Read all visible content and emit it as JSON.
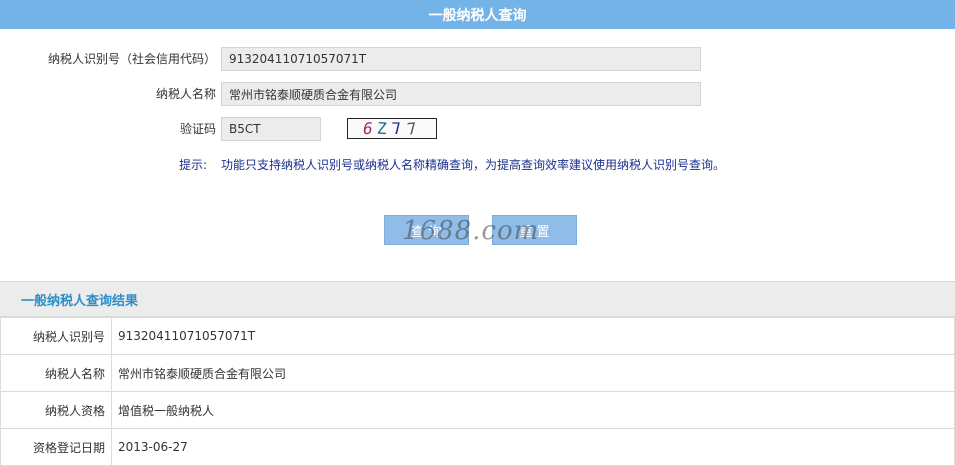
{
  "header": {
    "title": "一般纳税人查询"
  },
  "form": {
    "taxpayer_id_label": "纳税人识别号（社会信用代码）",
    "taxpayer_id_value": "91320411071057071T",
    "taxpayer_name_label": "纳税人名称",
    "taxpayer_name_value": "常州市铭泰顺硬质合金有限公司",
    "captcha_label": "验证码",
    "captcha_input_value": "B5CT",
    "captcha_image_chars": [
      "6",
      "Z",
      "7",
      "7"
    ],
    "tip_label": "提示:",
    "tip_text": "功能只支持纳税人识别号或纳税人名称精确查询，为提高查询效率建议使用纳税人识别号查询。"
  },
  "buttons": {
    "query_label": "查 询",
    "reset_label": "重 置"
  },
  "watermark": "1688.com",
  "result": {
    "title": "一般纳税人查询结果",
    "rows": [
      {
        "key": "纳税人识别号",
        "value": "91320411071057071T"
      },
      {
        "key": "纳税人名称",
        "value": "常州市铭泰顺硬质合金有限公司"
      },
      {
        "key": "纳税人资格",
        "value": "增值税一般纳税人"
      },
      {
        "key": "资格登记日期",
        "value": "2013-06-27"
      }
    ]
  },
  "colors": {
    "header_bg": "#74b3e8",
    "button_bg": "#8fbde8",
    "tip_text": "#1a2f8f",
    "result_title": "#2d8fc7"
  }
}
